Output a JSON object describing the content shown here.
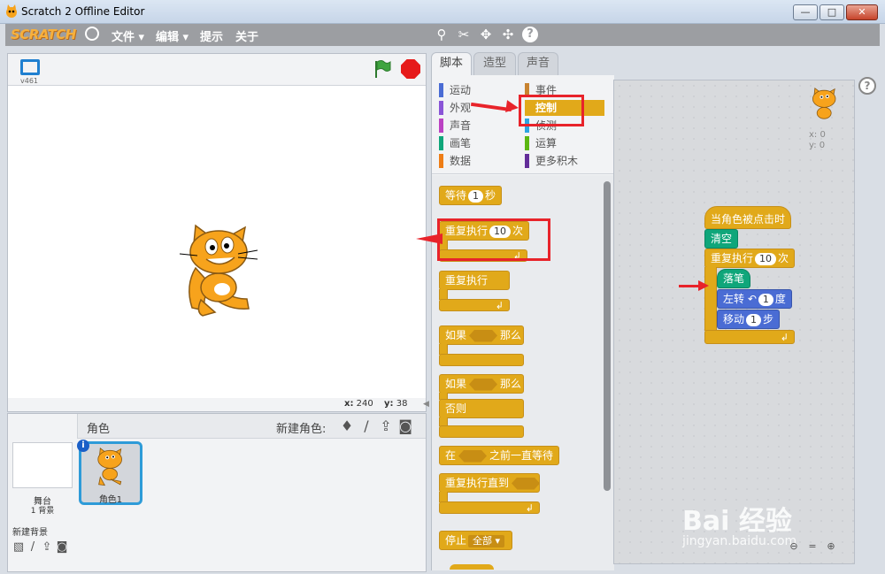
{
  "window": {
    "title": "Scratch 2 Offline Editor",
    "min": "—",
    "max": "□",
    "close": "✕"
  },
  "menubar": {
    "logo": "SCRATCH",
    "file": "文件 ▾",
    "edit": "编辑 ▾",
    "tips": "提示",
    "about": "关于",
    "tools": [
      "duplicate-icon",
      "delete-icon",
      "grow-icon",
      "shrink-icon",
      "help-icon"
    ]
  },
  "stage": {
    "version": "v461",
    "coord_x_label": "x:",
    "coord_x": "240",
    "coord_y_label": "y:",
    "coord_y": "38"
  },
  "sprites": {
    "title": "角色",
    "new_sprite": "新建角色:",
    "stage_label": "舞台",
    "stage_count": "1 背景",
    "new_backdrop": "新建背景",
    "sprite_name": "角色1"
  },
  "tabs": [
    "脚本",
    "造型",
    "声音"
  ],
  "categories": {
    "left": [
      {
        "label": "运动",
        "color": "#4a6cd4"
      },
      {
        "label": "外观",
        "color": "#8a55d7"
      },
      {
        "label": "声音",
        "color": "#bb42c3"
      },
      {
        "label": "画笔",
        "color": "#0fa67a"
      },
      {
        "label": "数据",
        "color": "#ee7d16"
      }
    ],
    "right": [
      {
        "label": "事件",
        "color": "#c88330"
      },
      {
        "label": "控制",
        "color": "#e1a91a"
      },
      {
        "label": "侦测",
        "color": "#2ca5e2"
      },
      {
        "label": "运算",
        "color": "#5cb712"
      },
      {
        "label": "更多积木",
        "color": "#632d99"
      }
    ]
  },
  "palette_blocks": {
    "wait": {
      "pre": "等待",
      "val": "1",
      "post": "秒"
    },
    "repeat": {
      "pre": "重复执行",
      "val": "10",
      "post": "次"
    },
    "forever": "重复执行",
    "if_then": {
      "pre": "如果",
      "post": "那么"
    },
    "if_else": {
      "pre": "如果",
      "post": "那么",
      "else": "否则"
    },
    "wait_until": {
      "pre": "在",
      "post": "之前一直等待"
    },
    "repeat_until": "重复执行直到",
    "stop": {
      "pre": "停止",
      "val": "全部 ▾"
    }
  },
  "script": {
    "hat": "当角色被点击时",
    "clear": "清空",
    "repeat": {
      "pre": "重复执行",
      "val": "10",
      "post": "次"
    },
    "pen_down": "落笔",
    "turn": {
      "pre": "左转",
      "val": "1",
      "post": "度"
    },
    "move": {
      "pre": "移动",
      "val": "1",
      "post": "步"
    },
    "sprite_x": "x: 0",
    "sprite_y": "y: 0"
  },
  "watermark": {
    "main": "Bai 经验",
    "sub": "jingyan.baidu.com"
  },
  "colors": {
    "control": "#e1a91a",
    "pen": "#0fa67a",
    "motion": "#4a6cd4",
    "annotation": "#e8232a"
  }
}
